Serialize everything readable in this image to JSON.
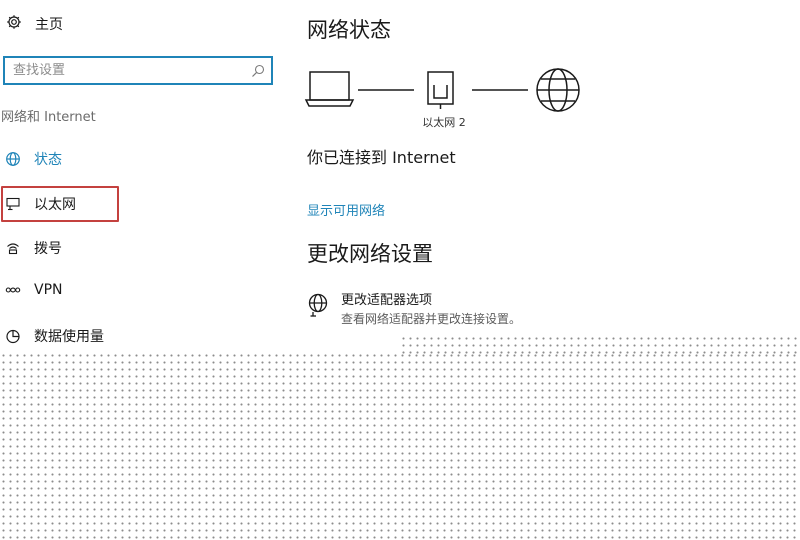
{
  "sidebar": {
    "home": {
      "label": "主页",
      "icon": "gear-icon"
    },
    "search": {
      "placeholder": "查找设置",
      "value": ""
    },
    "section_title": "网络和 Internet",
    "items": [
      {
        "label": "状态",
        "icon": "globe-icon",
        "active": true
      },
      {
        "label": "以太网",
        "icon": "ethernet-icon",
        "highlighted": true
      },
      {
        "label": "拨号",
        "icon": "dialup-icon"
      },
      {
        "label": "VPN",
        "icon": "vpn-icon"
      },
      {
        "label": "数据使用量",
        "icon": "data-usage-icon"
      }
    ]
  },
  "main": {
    "title": "网络状态",
    "diagram": {
      "adapter_label": "以太网 2"
    },
    "connected_text": "你已连接到 Internet",
    "show_networks_link": "显示可用网络",
    "change_title": "更改网络设置",
    "adapter_option": {
      "title": "更改适配器选项",
      "description": "查看网络适配器并更改连接设置。"
    }
  },
  "colors": {
    "accent": "#1f84b8",
    "highlight_border": "#c4413f",
    "text": "#1a1a1a",
    "secondary_text": "#6b6b6b"
  }
}
